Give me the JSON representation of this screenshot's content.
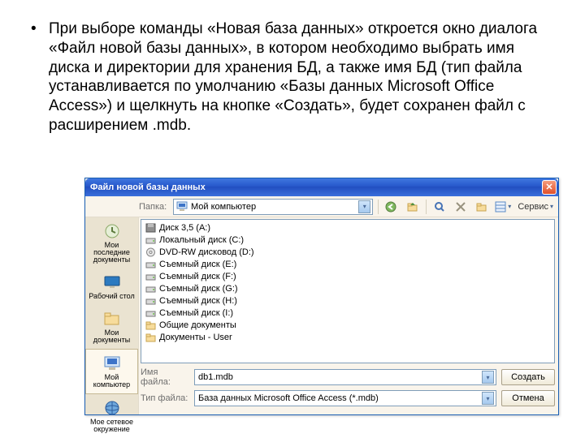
{
  "bullet_text": "При выборе команды «Новая база данных» откроется окно диалога «Файл новой базы данных», в котором необходимо выбрать имя диска и директории для хранения БД, а также имя БД (тип файла устанавливается по умолчанию «Базы данных Microsoft Office Access») и щелкнуть на кнопке «Создать», будет сохранен файл с расширением .mdb.",
  "dialog": {
    "title": "Файл новой базы данных",
    "close_glyph": "✕",
    "topbar": {
      "folder_label": "Папка:",
      "current_folder": "Мой компьютер",
      "tools_label": "Сервис"
    },
    "sidebar": [
      {
        "label": "Мои последние документы"
      },
      {
        "label": "Рабочий стол"
      },
      {
        "label": "Мои документы"
      },
      {
        "label": "Мой компьютер"
      },
      {
        "label": "Мое сетевое окружение"
      }
    ],
    "drives": [
      {
        "label": "Диск 3,5 (A:)",
        "kind": "floppy"
      },
      {
        "label": "Локальный диск (C:)",
        "kind": "hdd"
      },
      {
        "label": "DVD-RW дисковод (D:)",
        "kind": "cd"
      },
      {
        "label": "Съемный диск (E:)",
        "kind": "hdd"
      },
      {
        "label": "Съемный диск (F:)",
        "kind": "hdd"
      },
      {
        "label": "Съемный диск (G:)",
        "kind": "hdd"
      },
      {
        "label": "Съемный диск (H:)",
        "kind": "hdd"
      },
      {
        "label": "Съемный диск (I:)",
        "kind": "hdd"
      },
      {
        "label": "Общие документы",
        "kind": "folder"
      },
      {
        "label": "Документы - User",
        "kind": "folder"
      }
    ],
    "form": {
      "filename_label": "Имя файла:",
      "filename_value": "db1.mdb",
      "filetype_label": "Тип файла:",
      "filetype_value": "База данных Microsoft Office Access (*.mdb)",
      "create_label": "Создать",
      "cancel_label": "Отмена"
    }
  }
}
